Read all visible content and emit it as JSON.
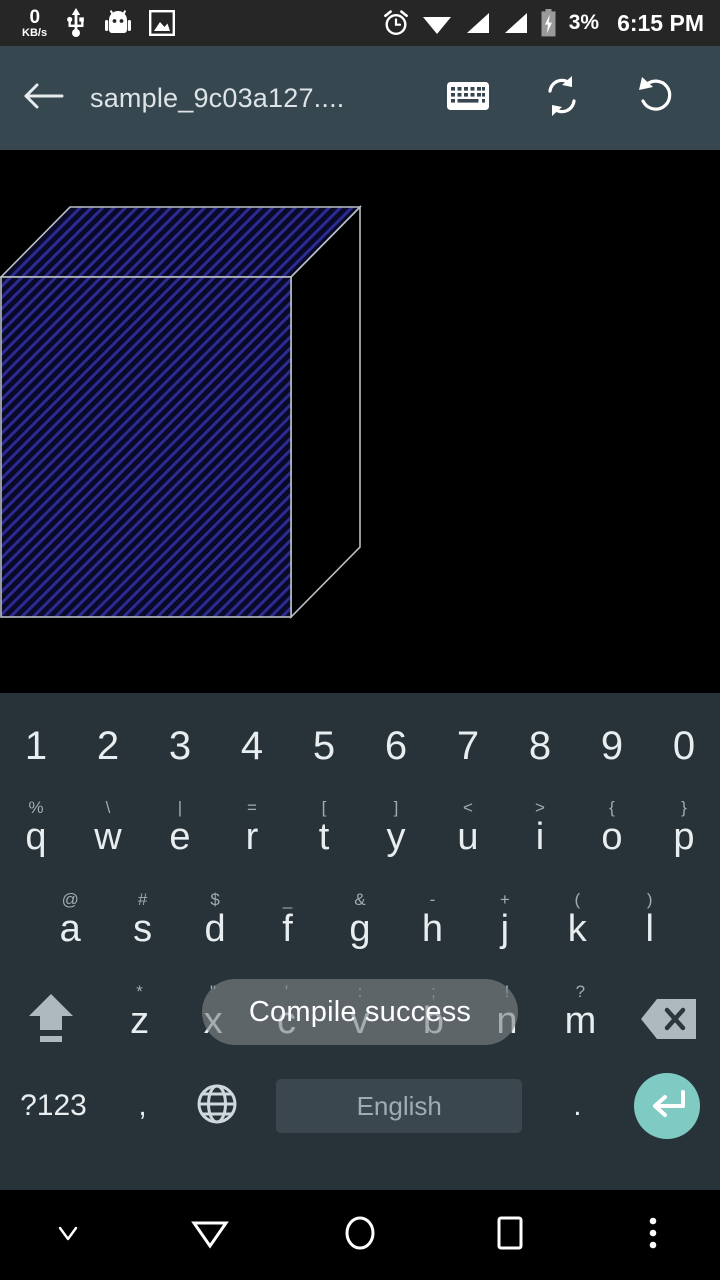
{
  "status_bar": {
    "net_speed_value": "0",
    "net_speed_unit": "KB/s",
    "icons": [
      "usb-icon",
      "android-head-icon",
      "image-icon",
      "alarm-icon",
      "wifi-icon",
      "signal-1-icon",
      "signal-2-icon",
      "battery-charging-icon"
    ],
    "battery_percent": "3%",
    "time": "6:15 PM"
  },
  "app_bar": {
    "back_label": "back-arrow",
    "title": "sample_9c03a127....",
    "actions": [
      "keyboard-icon",
      "sync-icon",
      "undo-icon"
    ],
    "background": "#37474f"
  },
  "canvas": {
    "background": "#000000",
    "shape": "3d-box-wireframe",
    "fill_color": "#151545",
    "hatch_color": "#2a2a8c",
    "edge_color": "#b9bfc2"
  },
  "keyboard": {
    "background": "#283339",
    "row_numbers": [
      {
        "main": "1",
        "sub": ""
      },
      {
        "main": "2",
        "sub": ""
      },
      {
        "main": "3",
        "sub": ""
      },
      {
        "main": "4",
        "sub": ""
      },
      {
        "main": "5",
        "sub": ""
      },
      {
        "main": "6",
        "sub": ""
      },
      {
        "main": "7",
        "sub": ""
      },
      {
        "main": "8",
        "sub": ""
      },
      {
        "main": "9",
        "sub": ""
      },
      {
        "main": "0",
        "sub": ""
      }
    ],
    "row_q": [
      {
        "main": "q",
        "sub": "%"
      },
      {
        "main": "w",
        "sub": "\\"
      },
      {
        "main": "e",
        "sub": "|"
      },
      {
        "main": "r",
        "sub": "="
      },
      {
        "main": "t",
        "sub": "["
      },
      {
        "main": "y",
        "sub": "]"
      },
      {
        "main": "u",
        "sub": "<"
      },
      {
        "main": "i",
        "sub": ">"
      },
      {
        "main": "o",
        "sub": "{"
      },
      {
        "main": "p",
        "sub": "}"
      }
    ],
    "row_a": [
      {
        "main": "a",
        "sub": "@"
      },
      {
        "main": "s",
        "sub": "#"
      },
      {
        "main": "d",
        "sub": "$"
      },
      {
        "main": "f",
        "sub": "_"
      },
      {
        "main": "g",
        "sub": "&"
      },
      {
        "main": "h",
        "sub": "-"
      },
      {
        "main": "j",
        "sub": "+"
      },
      {
        "main": "k",
        "sub": "("
      },
      {
        "main": "l",
        "sub": ")"
      }
    ],
    "row_z": [
      {
        "main": "z",
        "sub": "*"
      },
      {
        "main": "x",
        "sub": "\""
      },
      {
        "main": "c",
        "sub": "'"
      },
      {
        "main": "v",
        "sub": ":"
      },
      {
        "main": "b",
        "sub": ";"
      },
      {
        "main": "n",
        "sub": "!"
      },
      {
        "main": "m",
        "sub": "?"
      }
    ],
    "shift_label": "shift-icon",
    "delete_label": "backspace-icon",
    "symbols_label": "?123",
    "comma_label": ",",
    "globe_label": "language-globe-icon",
    "space_label": "English",
    "period_label": ".",
    "enter_label": "enter-icon",
    "enter_color": "#7fcbc3",
    "space_key_color": "#3b474e"
  },
  "toast": {
    "message": "Compile success"
  },
  "nav_bar": {
    "buttons": [
      "hide-keyboard-icon",
      "back-icon",
      "home-icon",
      "recents-icon",
      "overflow-menu-icon"
    ],
    "background": "#000000"
  }
}
